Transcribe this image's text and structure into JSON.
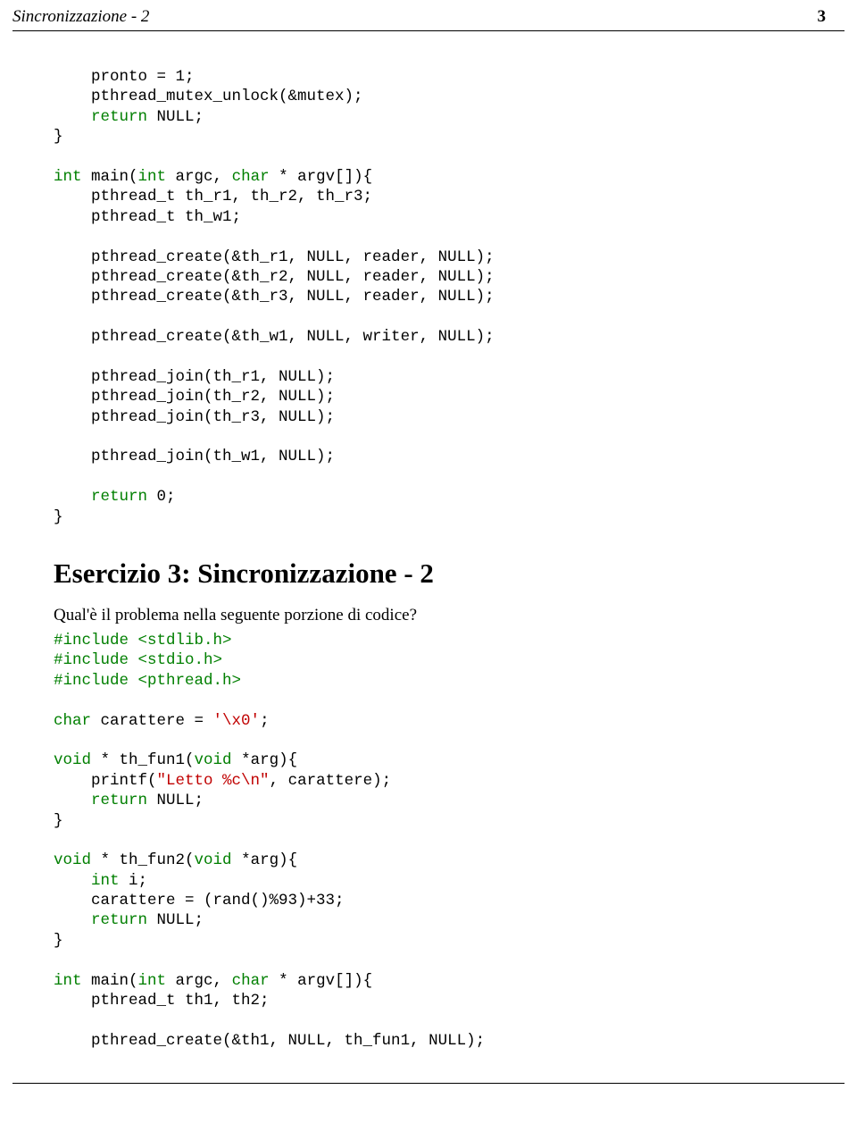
{
  "header": {
    "title": "Sincronizzazione - 2",
    "page_number": "3"
  },
  "code_block_1": {
    "l1a": "    pronto = 1;",
    "l2a": "    pthread_mutex_unlock(&mutex);",
    "l3k": "    return",
    "l3a": " NULL;",
    "l4a": "}",
    "l5a": "",
    "l6k1": "int",
    "l6a1": " main(",
    "l6k2": "int",
    "l6a2": " argc, ",
    "l6k3": "char",
    "l6a3": " * argv[]){",
    "l7a": "    pthread_t th_r1, th_r2, th_r3;",
    "l8a": "    pthread_t th_w1;",
    "l9a": "",
    "l10a": "    pthread_create(&th_r1, NULL, reader, NULL);",
    "l11a": "    pthread_create(&th_r2, NULL, reader, NULL);",
    "l12a": "    pthread_create(&th_r3, NULL, reader, NULL);",
    "l13a": "",
    "l14a": "    pthread_create(&th_w1, NULL, writer, NULL);",
    "l15a": "",
    "l16a": "    pthread_join(th_r1, NULL);",
    "l17a": "    pthread_join(th_r2, NULL);",
    "l18a": "    pthread_join(th_r3, NULL);",
    "l19a": "",
    "l20a": "    pthread_join(th_w1, NULL);",
    "l21a": "",
    "l22k": "    return",
    "l22a": " 0;",
    "l23a": "}"
  },
  "exercise": {
    "heading": "Esercizio 3:  Sincronizzazione - 2",
    "question": "Qual'è il problema nella seguente porzione di codice?"
  },
  "code_block_2": {
    "l1p": "#include <stdlib.h>",
    "l2p": "#include <stdio.h>",
    "l3p": "#include <pthread.h>",
    "l4a": "",
    "l5k": "char",
    "l5a": " carattere = ",
    "l5s": "'\\x0'",
    "l5b": ";",
    "l6a": "",
    "l7k1": "void",
    "l7a1": " * th_fun1(",
    "l7k2": "void",
    "l7a2": " *arg){",
    "l8a": "    printf(",
    "l8s": "\"Letto %c\\n\"",
    "l8b": ", carattere);",
    "l9k": "    return",
    "l9a": " NULL;",
    "l10a": "}",
    "l11a": "",
    "l12k1": "void",
    "l12a1": " * th_fun2(",
    "l12k2": "void",
    "l12a2": " *arg){",
    "l13k": "    int",
    "l13a": " i;",
    "l14a": "    carattere = (rand()%93)+33;",
    "l15k": "    return",
    "l15a": " NULL;",
    "l16a": "}",
    "l17a": "",
    "l18k1": "int",
    "l18a1": " main(",
    "l18k2": "int",
    "l18a2": " argc, ",
    "l18k3": "char",
    "l18a3": " * argv[]){",
    "l19a": "    pthread_t th1, th2;",
    "l20a": "",
    "l21a": "    pthread_create(&th1, NULL, th_fun1, NULL);"
  }
}
